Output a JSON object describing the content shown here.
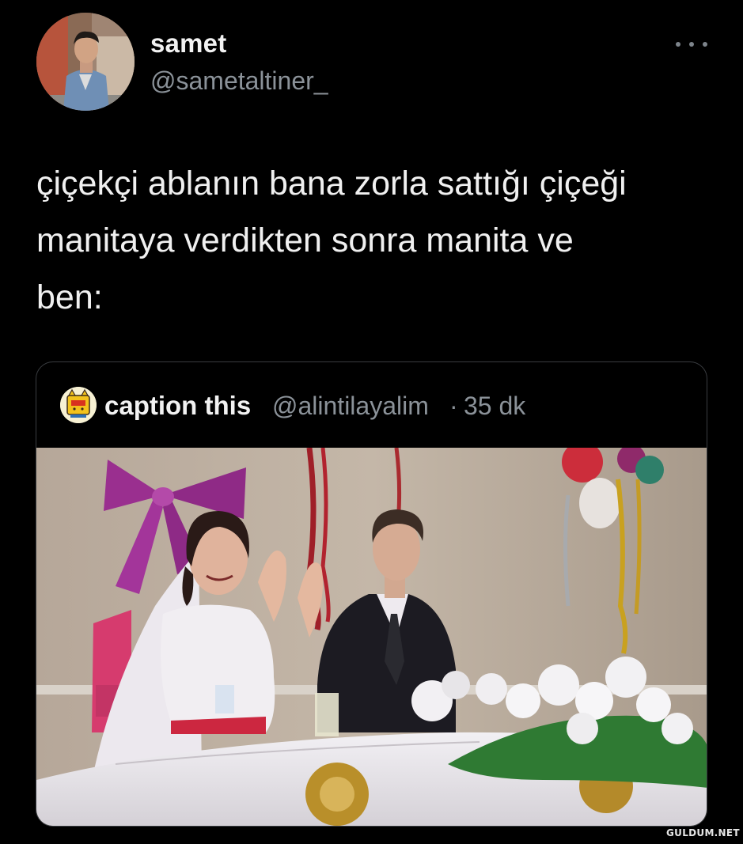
{
  "tweet": {
    "author": {
      "name": "samet",
      "handle": "@sametaltiner_"
    },
    "more_icon": "more-horizontal-icon",
    "text": "çiçekçi ablanın bana zorla sattığı çiçeği manitaya verdikten sonra manita ve ben:",
    "text_lines": [
      "çiçekçi ablanın bana zorla sattığı çiçeği",
      "manitaya verdikten sonra manita ve",
      "ben:"
    ]
  },
  "quoted_tweet": {
    "author": {
      "name": "caption this",
      "handle": "@alintilayalim",
      "separator": "·",
      "time": "35 dk"
    },
    "media_description_icon": "photo-icon"
  },
  "watermark": "GULDUM.NET",
  "colors": {
    "background": "#000000",
    "primary_text": "#f0f0f0",
    "secondary_text": "#8b9299",
    "card_border": "#3a3d41"
  }
}
